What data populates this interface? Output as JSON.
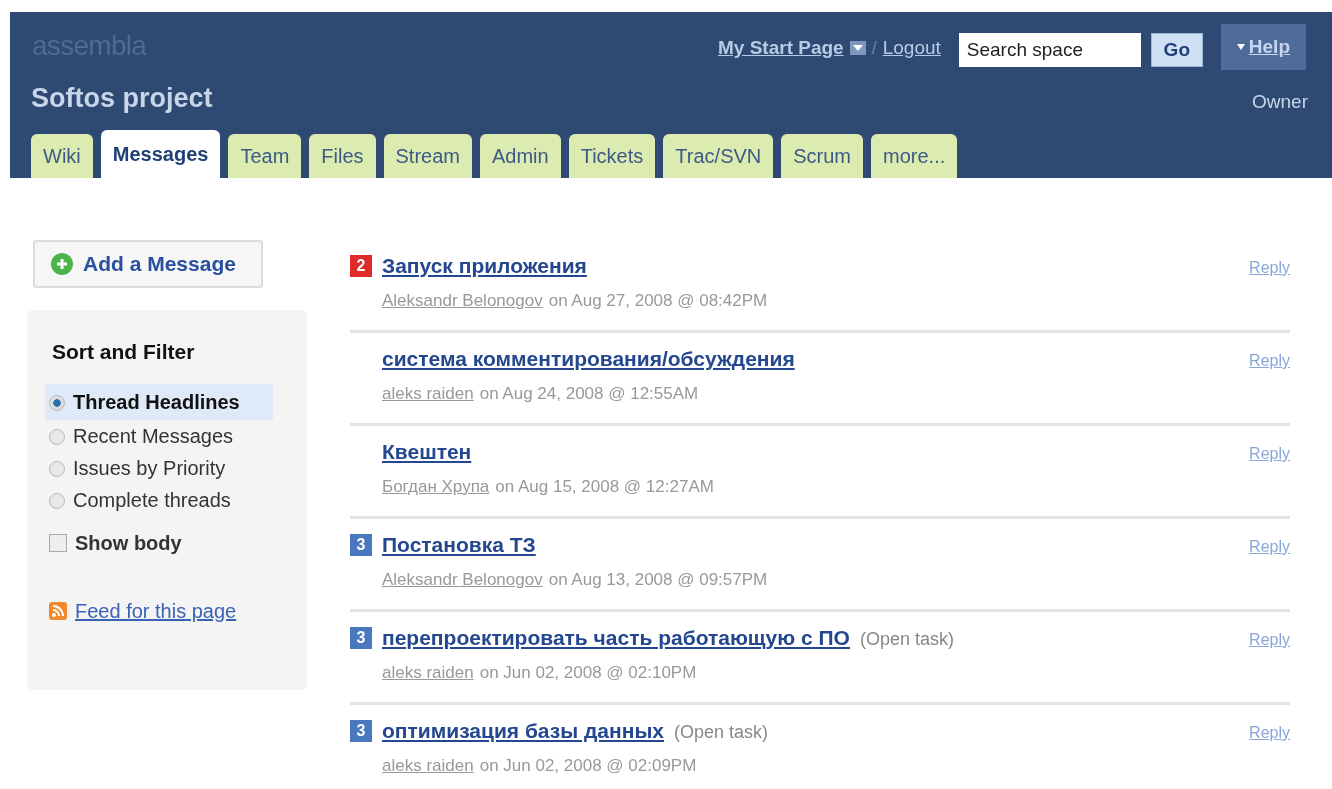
{
  "header": {
    "logo": "assembla",
    "project": "Softos project",
    "role": "Owner",
    "start_page": "My Start Page",
    "separator": "/",
    "logout": "Logout",
    "search": {
      "value": "Search space"
    },
    "go": "Go",
    "help": "Help"
  },
  "tabs": [
    {
      "label": "Wiki",
      "selected": false
    },
    {
      "label": "Messages",
      "selected": true
    },
    {
      "label": "Team",
      "selected": false
    },
    {
      "label": "Files",
      "selected": false
    },
    {
      "label": "Stream",
      "selected": false
    },
    {
      "label": "Admin",
      "selected": false
    },
    {
      "label": "Tickets",
      "selected": false
    },
    {
      "label": "Trac/SVN",
      "selected": false
    },
    {
      "label": "Scrum",
      "selected": false
    },
    {
      "label": "more...",
      "selected": false
    }
  ],
  "sidebar": {
    "add_button": "Add a Message",
    "filter_title": "Sort and Filter",
    "options": [
      {
        "label": "Thread Headlines",
        "selected": true
      },
      {
        "label": "Recent Messages",
        "selected": false
      },
      {
        "label": "Issues by Priority",
        "selected": false
      },
      {
        "label": "Complete threads",
        "selected": false
      }
    ],
    "show_body": {
      "label": "Show body",
      "checked": false
    },
    "feed": "Feed for this page"
  },
  "messages": [
    {
      "priority": "2",
      "color": "#e02a2a",
      "title": "Запуск приложения",
      "author": "Aleksandr Belonogov",
      "date": "on Aug 27, 2008 @ 08:42PM",
      "reply": "Reply"
    },
    {
      "title": "система комментирования/обсуждения",
      "author": "aleks raiden",
      "date": "on Aug 24, 2008 @ 12:55AM",
      "reply": "Reply"
    },
    {
      "title": "Квештен",
      "author": "Богдан Хрупа",
      "date": "on Aug 15, 2008 @ 12:27AM",
      "reply": "Reply"
    },
    {
      "priority": "3",
      "color": "#4a78c0",
      "title": "Постановка ТЗ",
      "author": "Aleksandr Belonogov",
      "date": "on Aug 13, 2008 @ 09:57PM",
      "reply": "Reply"
    },
    {
      "priority": "3",
      "color": "#4a78c0",
      "title": "перепроектировать часть работающую с ПО",
      "status": "(Open task)",
      "author": "aleks raiden",
      "date": "on Jun 02, 2008 @ 02:10PM",
      "reply": "Reply"
    },
    {
      "priority": "3",
      "color": "#4a78c0",
      "title": "оптимизация базы данных",
      "status": "(Open task)",
      "author": "aleks raiden",
      "date": "on Jun 02, 2008 @ 02:09PM",
      "reply": "Reply"
    }
  ]
}
